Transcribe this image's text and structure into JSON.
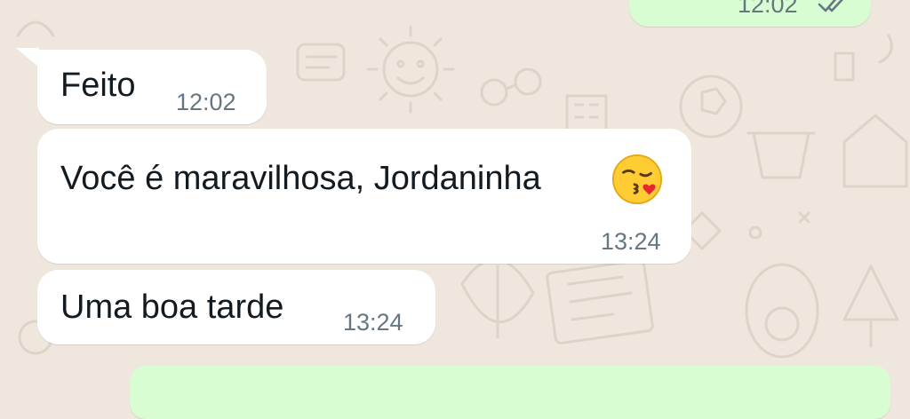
{
  "chat": {
    "messages": [
      {
        "direction": "outgoing",
        "text": "",
        "time": "12:02",
        "status": "read"
      },
      {
        "direction": "incoming",
        "text": "Feito",
        "time": "12:02"
      },
      {
        "direction": "incoming",
        "text": "Você é maravilhosa, Jordaninha",
        "emoji": "face-blowing-a-kiss",
        "time": "13:24"
      },
      {
        "direction": "incoming",
        "text": "Uma boa tarde",
        "time": "13:24"
      },
      {
        "direction": "outgoing",
        "text": "",
        "time": ""
      }
    ]
  },
  "colors": {
    "wallpaper": "#efe7de",
    "incoming_bubble": "#ffffff",
    "outgoing_bubble": "#d9fdd3",
    "time_text": "#667781",
    "message_text": "#111b21"
  }
}
